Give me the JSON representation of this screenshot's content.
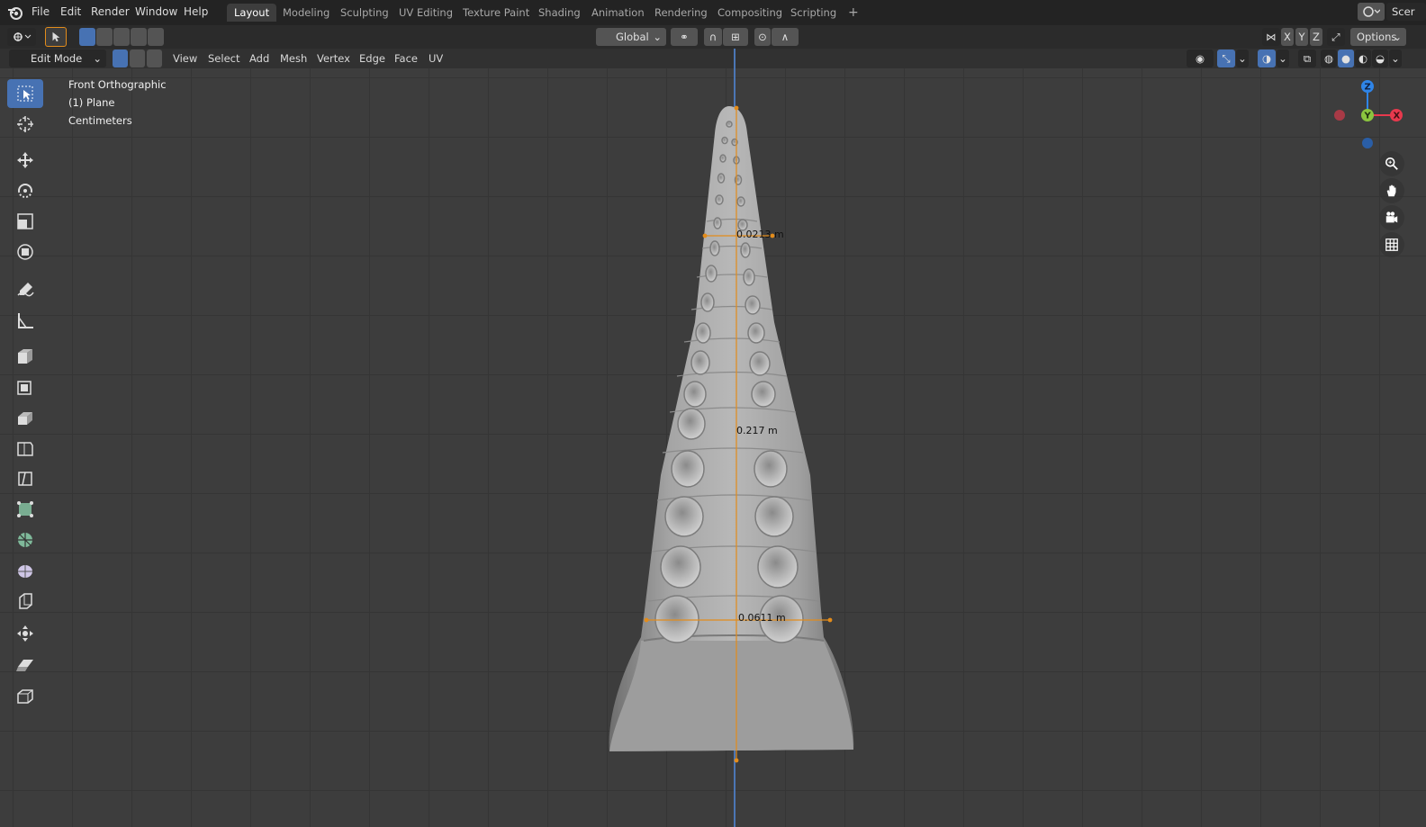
{
  "app": {
    "menus": [
      "File",
      "Edit",
      "Render",
      "Window",
      "Help"
    ],
    "workspace_tabs": [
      "Layout",
      "Modeling",
      "Sculpting",
      "UV Editing",
      "Texture Paint",
      "Shading",
      "Animation",
      "Rendering",
      "Compositing",
      "Scripting"
    ],
    "active_tab": "Layout",
    "add_tab_label": "+",
    "scene_label": "Scer"
  },
  "toolbar": {
    "orientation": "Global",
    "axis_x": "X",
    "axis_y": "Y",
    "axis_z": "Z",
    "options_label": "Options"
  },
  "header": {
    "mode": "Edit Mode",
    "menus": [
      "View",
      "Select",
      "Add",
      "Mesh",
      "Vertex",
      "Edge",
      "Face",
      "UV"
    ]
  },
  "viewport": {
    "view_name": "Front Orthographic",
    "object_name": "(1) Plane",
    "units": "Centimeters",
    "measurements": {
      "top": "0.0213 m",
      "height": "0.217 m",
      "bottom": "0.0611 m"
    }
  },
  "gizmo": {
    "z": "Z",
    "y": "Y",
    "x": "X"
  },
  "colors": {
    "accent": "#4772b3",
    "measure": "#e38c1b",
    "axis_x": "#e8394d",
    "axis_y": "#8bc53f",
    "axis_z": "#2f85e8"
  }
}
